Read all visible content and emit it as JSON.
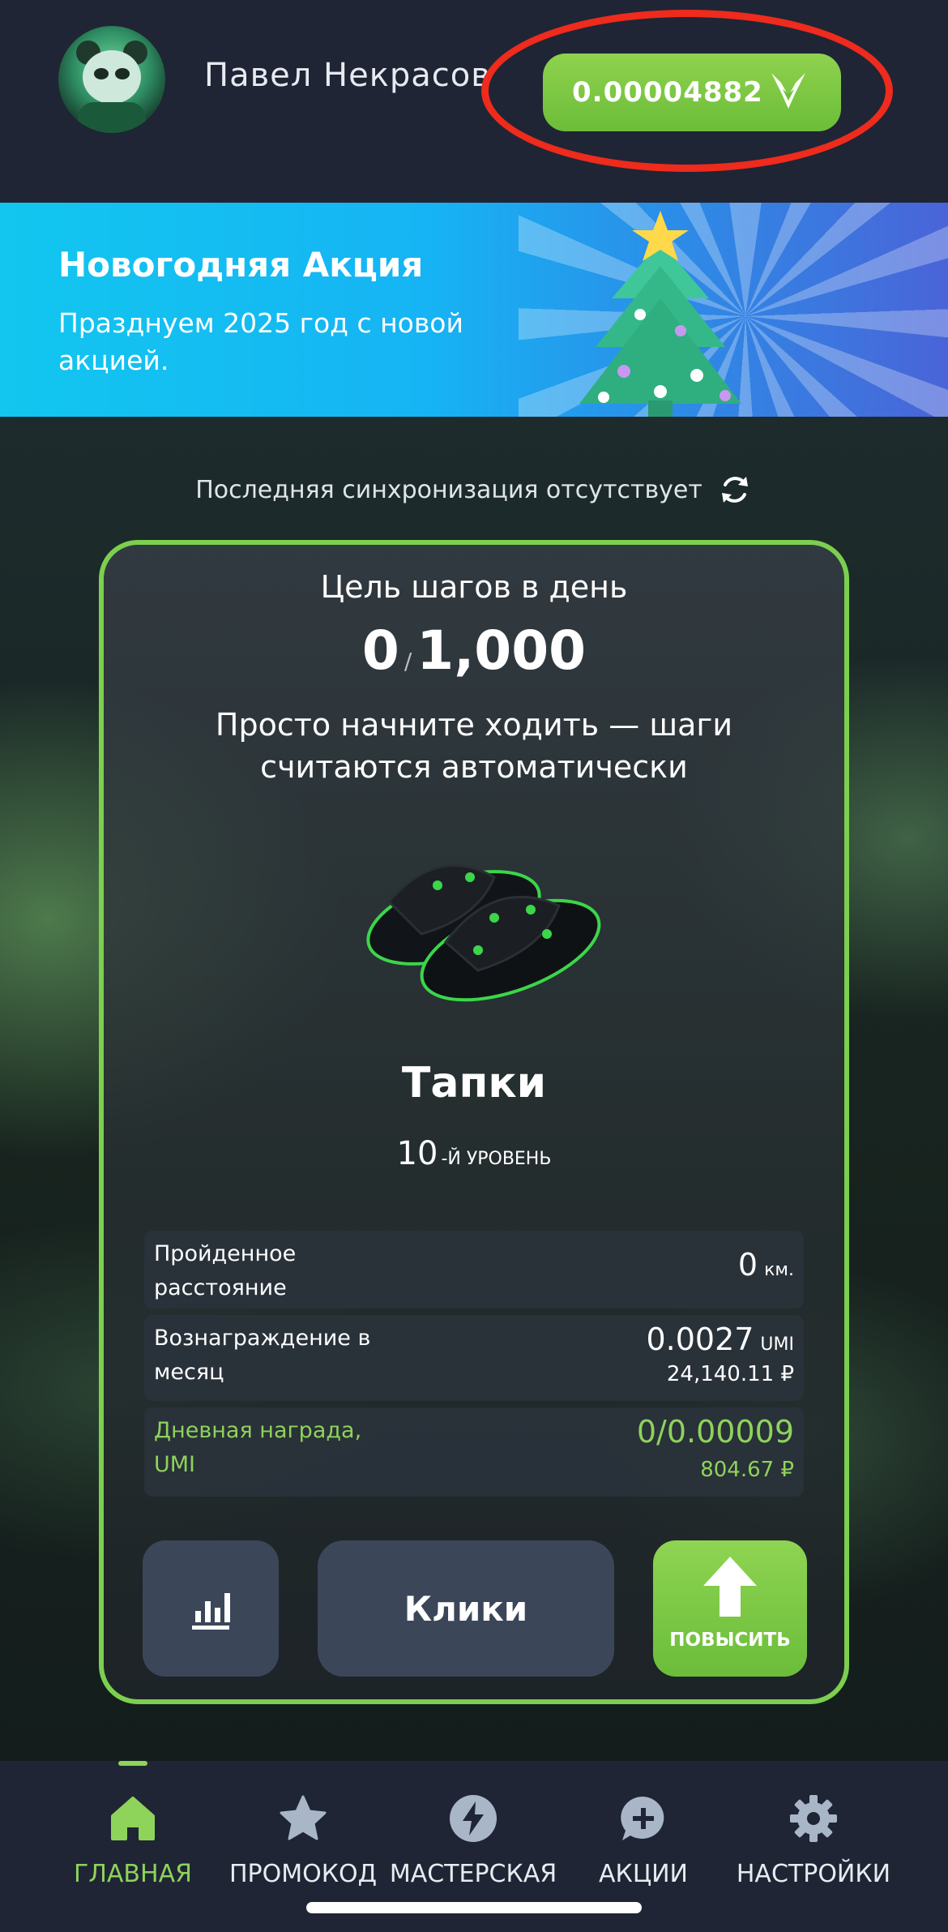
{
  "header": {
    "user_name": "Павел Некрасов",
    "balance": "0.00004882"
  },
  "banner": {
    "title": "Новогодняя Акция",
    "subtitle": "Празднуем 2025 год с новой акцией."
  },
  "sync": {
    "text": "Последняя синхронизация отсутствует"
  },
  "card": {
    "goal_title": "Цель шагов в день",
    "steps_current": "0",
    "steps_separator": "/",
    "steps_goal": "1,000",
    "hint": "Просто начните ходить — шаги считаются автоматически",
    "item_name": "Тапки",
    "level_number": "10",
    "level_suffix": "-Й УРОВЕНЬ",
    "stats": {
      "distance_label": "Пройденное расстояние",
      "distance_value": "0",
      "distance_unit": "км.",
      "monthly_label": "Вознаграждение в месяц",
      "monthly_value": "0.0027",
      "monthly_unit": "UMI",
      "monthly_rub": "24,140.11 ₽",
      "daily_label": "Дневная награда, UMI",
      "daily_value": "0/0.00009",
      "daily_rub": "804.67 ₽"
    },
    "buttons": {
      "clicks": "Клики",
      "upgrade": "ПОВЫСИТЬ"
    }
  },
  "nav": {
    "items": [
      {
        "label": "ГЛАВНАЯ",
        "icon": "home-icon",
        "active": true
      },
      {
        "label": "ПРОМОКОД",
        "icon": "star-icon",
        "active": false
      },
      {
        "label": "МАСТЕРСКАЯ",
        "icon": "lightning-icon",
        "active": false
      },
      {
        "label": "АКЦИИ",
        "icon": "chat-plus-icon",
        "active": false
      },
      {
        "label": "НАСТРОЙКИ",
        "icon": "gear-icon",
        "active": false
      }
    ]
  },
  "colors": {
    "accent_green": "#8ed35a",
    "highlight_ring": "#ee2b1c",
    "background": "#1f2535"
  }
}
